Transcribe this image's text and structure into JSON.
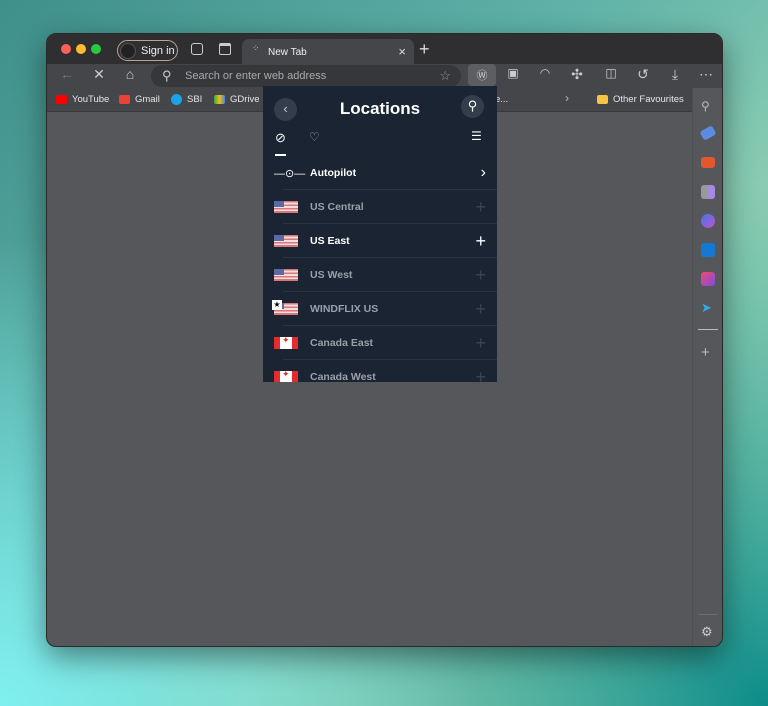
{
  "browser": {
    "sign_in": "Sign in",
    "tab_title": "New Tab",
    "address_placeholder": "Search or enter web address",
    "bookmarks": [
      {
        "label": "YouTube",
        "color": "#ff0000"
      },
      {
        "label": "Gmail",
        "color": "#ea4335"
      },
      {
        "label": "SBI",
        "color": "#1ba3e8"
      },
      {
        "label": "GDrive",
        "color": "#34a853"
      },
      {
        "label": "e..."
      }
    ],
    "other_favourites": "Other Favourites"
  },
  "popup": {
    "title": "Locations",
    "items": [
      {
        "label": "Autopilot",
        "state": "active"
      },
      {
        "label": "US Central",
        "flag": "us"
      },
      {
        "label": "US East",
        "flag": "us",
        "state": "active"
      },
      {
        "label": "US West",
        "flag": "us"
      },
      {
        "label": "WINDFLIX US",
        "flag": "us",
        "starred": true
      },
      {
        "label": "Canada East",
        "flag": "ca"
      },
      {
        "label": "Canada West",
        "flag": "ca"
      }
    ]
  }
}
